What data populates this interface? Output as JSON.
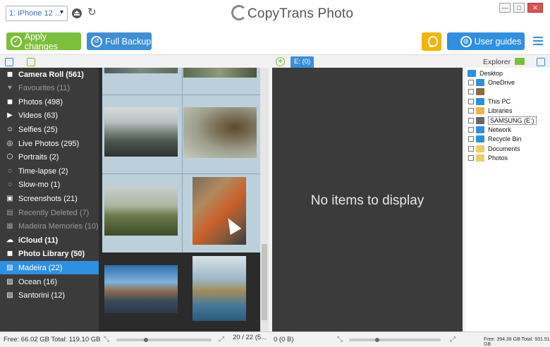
{
  "window": {
    "title": "CopyTrans Photo",
    "minimize": "—",
    "maximize": "□",
    "close": "✕"
  },
  "device": {
    "selected": "1: iPhone 12 ..."
  },
  "toolbar": {
    "apply_label": "Apply changes",
    "backup_label": "Full Backup",
    "guides_label": "User guides"
  },
  "preview_tab": {
    "label": "E: (0)"
  },
  "explorer_label": "Explorer",
  "sidebar": {
    "items": [
      {
        "label": "Camera Roll (561)",
        "icon": "camera-icon",
        "style": "bold"
      },
      {
        "label": "Favourites (11)",
        "icon": "heart-icon",
        "style": "dim"
      },
      {
        "label": "Photos (498)",
        "icon": "camera-icon",
        "style": "normal"
      },
      {
        "label": "Videos (63)",
        "icon": "video-icon",
        "style": "normal"
      },
      {
        "label": "Selfies (25)",
        "icon": "person-icon",
        "style": "normal"
      },
      {
        "label": "Live Photos (295)",
        "icon": "live-icon",
        "style": "normal"
      },
      {
        "label": "Portraits (2)",
        "icon": "cube-icon",
        "style": "normal"
      },
      {
        "label": "Time-lapse (2)",
        "icon": "timelapse-icon",
        "style": "normal"
      },
      {
        "label": "Slow-mo (1)",
        "icon": "slowmo-icon",
        "style": "normal"
      },
      {
        "label": "Screenshots (21)",
        "icon": "screenshot-icon",
        "style": "normal"
      },
      {
        "label": "Recently Deleted (7)",
        "icon": "trash-icon",
        "style": "dim"
      },
      {
        "label": "Madeira Memories (10)",
        "icon": "memories-icon",
        "style": "dim"
      },
      {
        "label": "iCloud (11)",
        "icon": "cloud-icon",
        "style": "bold"
      },
      {
        "label": "Photo Library (50)",
        "icon": "camera-icon",
        "style": "bold"
      },
      {
        "label": "Madeira (22)",
        "icon": "album-icon",
        "style": "selected"
      },
      {
        "label": "Ocean (16)",
        "icon": "album-icon",
        "style": "normal"
      },
      {
        "label": "Santorini (12)",
        "icon": "album-icon",
        "style": "normal"
      }
    ]
  },
  "preview": {
    "empty_text": "No items to display"
  },
  "explorer": {
    "items": [
      {
        "label": "Desktop",
        "icon": "desktop-icon",
        "color": "#2f8fe0"
      },
      {
        "label": "OneDrive",
        "icon": "onedrive-icon",
        "color": "#2f8fe0"
      },
      {
        "label": "",
        "icon": "user-folder-icon",
        "color": "#8a6d3b"
      },
      {
        "label": "This PC",
        "icon": "pc-icon",
        "color": "#2f8fe0"
      },
      {
        "label": "Libraries",
        "icon": "libraries-icon",
        "color": "#e8b84a"
      },
      {
        "label": "SAMSUNG (E:)",
        "icon": "drive-icon",
        "color": "#666666"
      },
      {
        "label": "Network",
        "icon": "network-icon",
        "color": "#2f8fe0"
      },
      {
        "label": "Recycle Bin",
        "icon": "recycle-icon",
        "color": "#2f8fe0"
      },
      {
        "label": "Documents",
        "icon": "folder-icon",
        "color": "#f2cc63"
      },
      {
        "label": "Photos",
        "icon": "folder-icon",
        "color": "#f2cc63"
      }
    ]
  },
  "status": {
    "left_storage": "Free: 66.02 GB Total: 119.10 GB",
    "photo_count": "20 / 22 (5...",
    "preview_count": "0 (0 B)",
    "right_storage": "Free: 394.38 GB Total: 931.51 GB"
  }
}
